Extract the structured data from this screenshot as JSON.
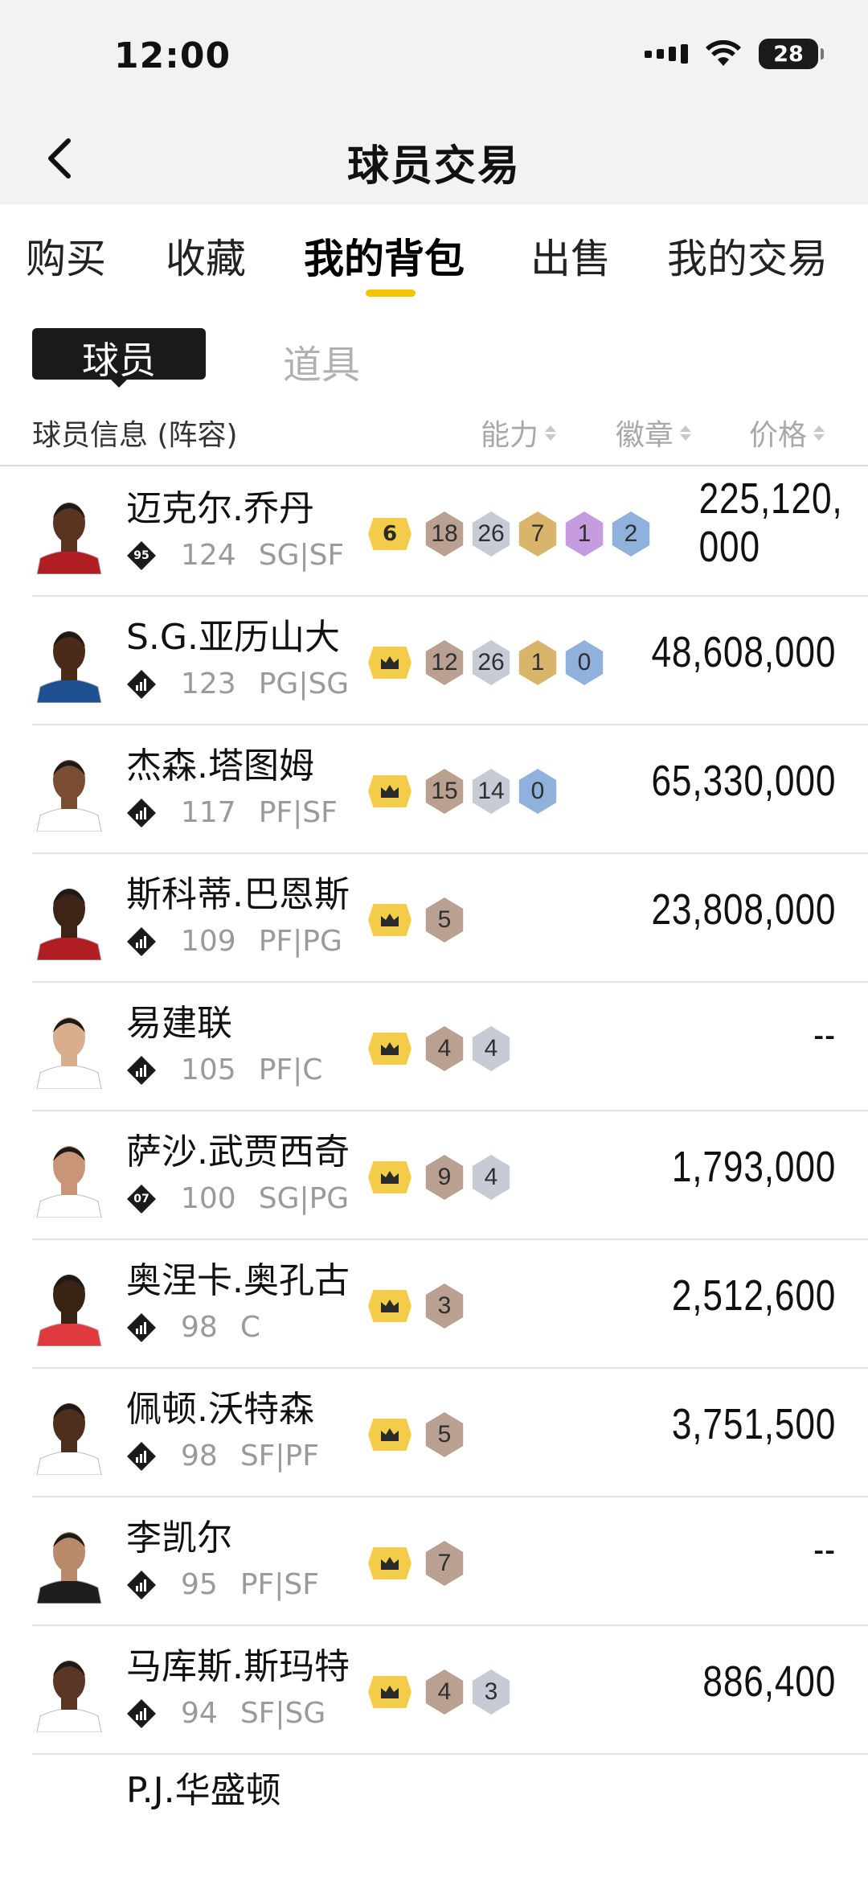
{
  "status_bar": {
    "time": "12:00",
    "battery": "28"
  },
  "nav": {
    "title": "球员交易"
  },
  "top_tabs": [
    {
      "label": "购买"
    },
    {
      "label": "收藏"
    },
    {
      "label": "我的背包"
    },
    {
      "label": "出售"
    },
    {
      "label": "我的交易"
    }
  ],
  "sub_tabs": [
    {
      "label": "球员"
    },
    {
      "label": "道具"
    }
  ],
  "list_header": {
    "info": "球员信息 (阵容)",
    "ability": "能力",
    "badges": "徽章",
    "price": "价格"
  },
  "colors": {
    "accent": "#f5c400",
    "crown": "#f3cd4a",
    "hex_gold": "#d9b56b",
    "hex_bronze": "#b9a090",
    "hex_silver": "#c6cbd6",
    "hex_purple": "#c69be0",
    "hex_blue": "#8fb1dc"
  },
  "players": [
    {
      "name": "迈克尔.乔丹",
      "team_icon": "team-95-icon",
      "team_label": "95",
      "ovr": "124",
      "pos": "SG|SF",
      "crown": "6",
      "badges": [
        {
          "n": "18",
          "c": "bronze"
        },
        {
          "n": "26",
          "c": "silver"
        },
        {
          "n": "7",
          "c": "gold"
        },
        {
          "n": "1",
          "c": "purple"
        },
        {
          "n": "2",
          "c": "blue"
        }
      ],
      "price": "225,120,000"
    },
    {
      "name": "S.G.亚历山大",
      "team_icon": "team-thunder-icon",
      "team_label": "",
      "ovr": "123",
      "pos": "PG|SG",
      "crown": "",
      "badges": [
        {
          "n": "12",
          "c": "bronze"
        },
        {
          "n": "26",
          "c": "silver"
        },
        {
          "n": "1",
          "c": "gold"
        },
        {
          "n": "0",
          "c": "blue"
        }
      ],
      "price": "48,608,000"
    },
    {
      "name": "杰森.塔图姆",
      "team_icon": "team-celtics-icon",
      "team_label": "",
      "ovr": "117",
      "pos": "PF|SF",
      "crown": "",
      "badges": [
        {
          "n": "15",
          "c": "bronze"
        },
        {
          "n": "14",
          "c": "silver"
        },
        {
          "n": "0",
          "c": "blue"
        }
      ],
      "price": "65,330,000"
    },
    {
      "name": "斯科蒂.巴恩斯",
      "team_icon": "team-raptors-icon",
      "team_label": "",
      "ovr": "109",
      "pos": "PF|PG",
      "crown": "",
      "badges": [
        {
          "n": "5",
          "c": "bronze"
        }
      ],
      "price": "23,808,000"
    },
    {
      "name": "易建联",
      "team_icon": "team-star-icon",
      "team_label": "",
      "ovr": "105",
      "pos": "PF|C",
      "crown": "",
      "badges": [
        {
          "n": "4",
          "c": "bronze"
        },
        {
          "n": "4",
          "c": "silver"
        }
      ],
      "price": "--"
    },
    {
      "name": "萨沙.武贾西奇",
      "team_icon": "team-07-icon",
      "team_label": "07",
      "ovr": "100",
      "pos": "SG|PG",
      "crown": "",
      "badges": [
        {
          "n": "9",
          "c": "bronze"
        },
        {
          "n": "4",
          "c": "silver"
        }
      ],
      "price": "1,793,000"
    },
    {
      "name": "奥涅卡.奥孔古",
      "team_icon": "team-hawks-icon",
      "team_label": "",
      "ovr": "98",
      "pos": "C",
      "crown": "",
      "badges": [
        {
          "n": "3",
          "c": "bronze"
        }
      ],
      "price": "2,512,600"
    },
    {
      "name": "佩顿.沃特森",
      "team_icon": "team-thunder-icon",
      "team_label": "",
      "ovr": "98",
      "pos": "SF|PF",
      "crown": "",
      "badges": [
        {
          "n": "5",
          "c": "bronze"
        }
      ],
      "price": "3,751,500"
    },
    {
      "name": "李凯尔",
      "team_icon": "team-star-icon",
      "team_label": "",
      "ovr": "95",
      "pos": "PF|SF",
      "crown": "",
      "badges": [
        {
          "n": "7",
          "c": "bronze"
        }
      ],
      "price": "--"
    },
    {
      "name": "马库斯.斯玛特",
      "team_icon": "team-grizzlies-icon",
      "team_label": "",
      "ovr": "94",
      "pos": "SF|SG",
      "crown": "",
      "badges": [
        {
          "n": "4",
          "c": "bronze"
        },
        {
          "n": "3",
          "c": "silver"
        }
      ],
      "price": "886,400"
    }
  ],
  "partial_player": {
    "name": "P.J.华盛顿"
  }
}
